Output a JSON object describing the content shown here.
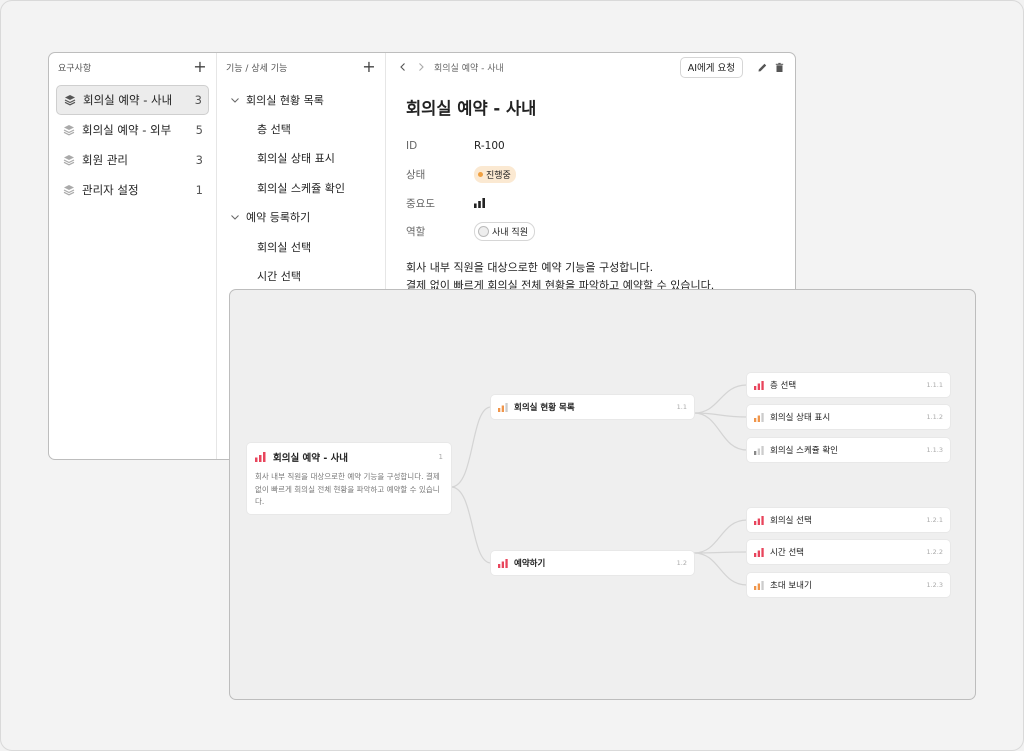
{
  "requirements": {
    "header": "요구사항",
    "items": [
      {
        "label": "회의실 예약 - 사내",
        "count": "3"
      },
      {
        "label": "회의실 예약 - 외부",
        "count": "5"
      },
      {
        "label": "회원 관리",
        "count": "3"
      },
      {
        "label": "관리자 설정",
        "count": "1"
      }
    ]
  },
  "features": {
    "header": "기능 / 상세 기능",
    "items": [
      {
        "label": "회의실 현황 목록",
        "level": "parent"
      },
      {
        "label": "층 선택",
        "level": "child"
      },
      {
        "label": "회의실 상태 표시",
        "level": "child"
      },
      {
        "label": "회의실 스케쥴 확인",
        "level": "child"
      },
      {
        "label": "예약 등록하기",
        "level": "parent"
      },
      {
        "label": "회의실 선택",
        "level": "child"
      },
      {
        "label": "시간 선택",
        "level": "child"
      }
    ]
  },
  "detail": {
    "breadcrumb": "회의실 예약 - 사내",
    "ai_button": "AI에게 요청",
    "title": "회의실 예약 - 사내",
    "id_label": "ID",
    "id_value": "R-100",
    "status_label": "상태",
    "status_value": "진행중",
    "priority_label": "중요도",
    "role_label": "역할",
    "role_value": "사내 직원",
    "description_line1": "회사 내부 직원을 대상으로한 예약 기능을 구성합니다.",
    "description_line2": "결제 없이 빠르게 회의실 전체 현황을 파악하고 예약할 수 있습니다."
  },
  "mindmap": {
    "root": {
      "label": "회의실 예약 - 사내",
      "number": "1",
      "description": "회사 내부 직원을 대상으로한 예약 기능을 구성합니다. 결제 없이 빠르게 회의실 전체 현황을 파악하고 예약할 수 있습니다."
    },
    "branches": [
      {
        "label": "회의실 현황 목록",
        "number": "1.1"
      },
      {
        "label": "예약하기",
        "number": "1.2"
      }
    ],
    "leaves": [
      {
        "label": "층 선택",
        "number": "1.1.1"
      },
      {
        "label": "회의실 상태 표시",
        "number": "1.1.2"
      },
      {
        "label": "회의실 스케쥴 확인",
        "number": "1.1.3"
      },
      {
        "label": "회의실 선택",
        "number": "1.2.1"
      },
      {
        "label": "시간 선택",
        "number": "1.2.2"
      },
      {
        "label": "초대 보내기",
        "number": "1.2.3"
      }
    ]
  },
  "colors": {
    "priority_high": "#e8455c",
    "priority_mid": "#f0954a",
    "priority_low": "#cccccc",
    "status_dot": "#f0a040"
  }
}
